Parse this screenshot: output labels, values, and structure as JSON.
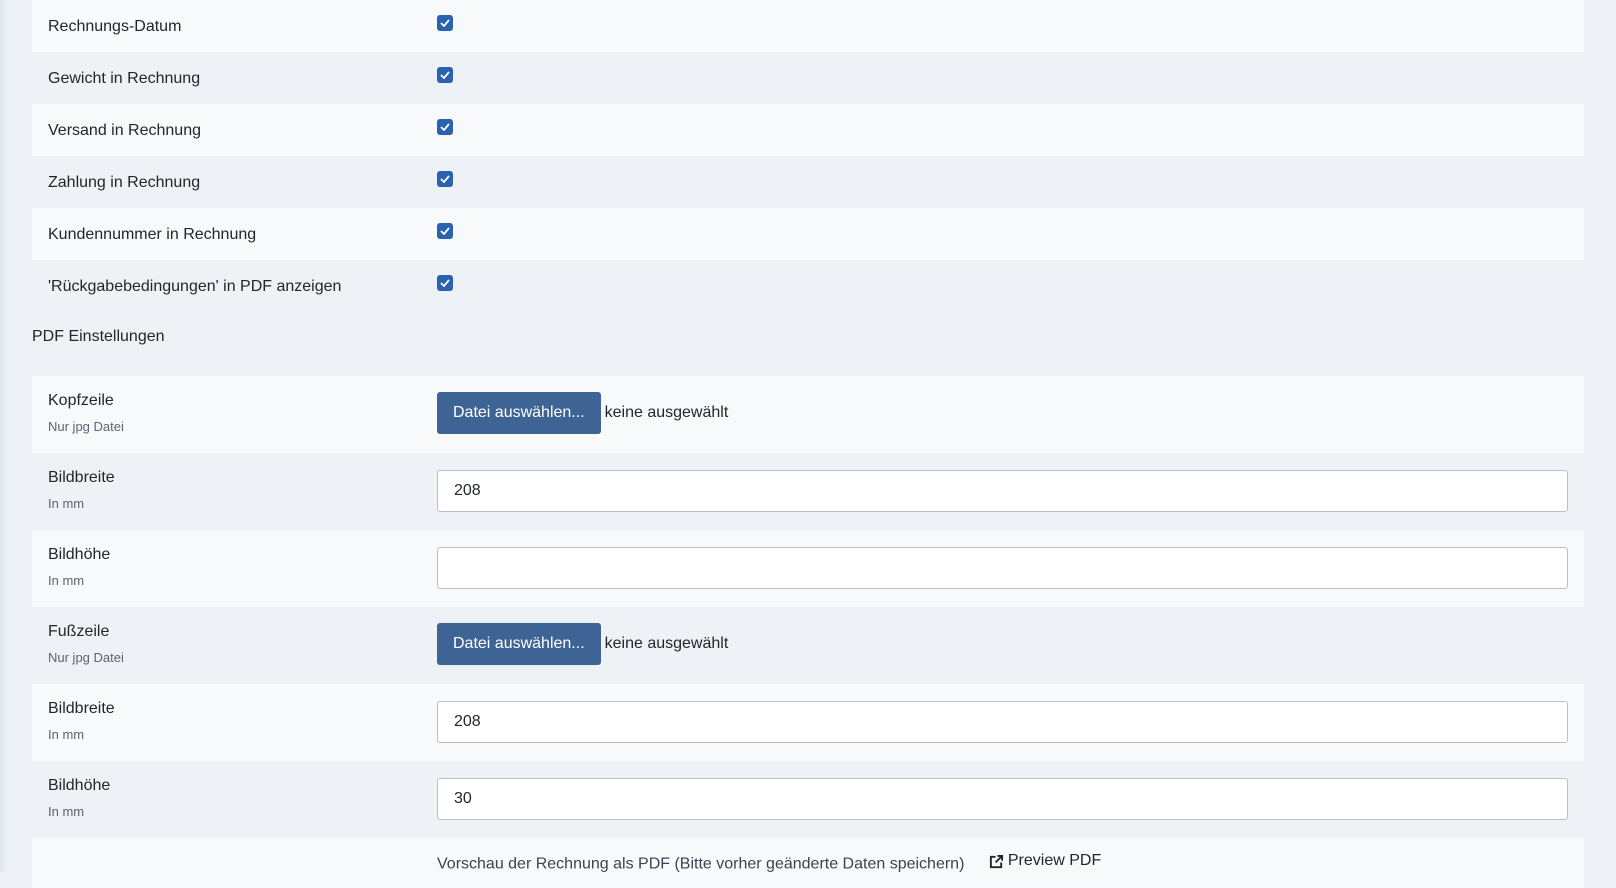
{
  "checkbox_options": [
    {
      "label": "Rechnungs-Datum",
      "checked": true
    },
    {
      "label": "Gewicht in Rechnung",
      "checked": true
    },
    {
      "label": "Versand in Rechnung",
      "checked": true
    },
    {
      "label": "Zahlung in Rechnung",
      "checked": true
    },
    {
      "label": "Kundennummer in Rechnung",
      "checked": true
    },
    {
      "label": "'Rückgabebedingungen' in PDF anzeigen",
      "checked": true
    }
  ],
  "pdf_section": {
    "title": "PDF Einstellungen",
    "header_file": {
      "label": "Kopfzeile",
      "hint": "Nur jpg Datei",
      "button": "Datei auswählen...",
      "status": "keine ausgewählt"
    },
    "header_width": {
      "label": "Bildbreite",
      "hint": "In mm",
      "value": "208"
    },
    "header_height": {
      "label": "Bildhöhe",
      "hint": "In mm",
      "value": ""
    },
    "footer_file": {
      "label": "Fußzeile",
      "hint": "Nur jpg Datei",
      "button": "Datei auswählen...",
      "status": "keine ausgewählt"
    },
    "footer_width": {
      "label": "Bildbreite",
      "hint": "In mm",
      "value": "208"
    },
    "footer_height": {
      "label": "Bildhöhe",
      "hint": "In mm",
      "value": "30"
    },
    "preview_text": "Vorschau der Rechnung als PDF (Bitte vorher geänderte Daten speichern)",
    "preview_link": "Preview PDF"
  },
  "colors": {
    "button_bg": "#3e6496",
    "checkbox_bg": "#2a62b0",
    "row_light": "#f8f9fb",
    "row_dark": "#eef2f6"
  },
  "icons": {
    "checkbox": "check-icon",
    "preview": "external-link-icon"
  }
}
